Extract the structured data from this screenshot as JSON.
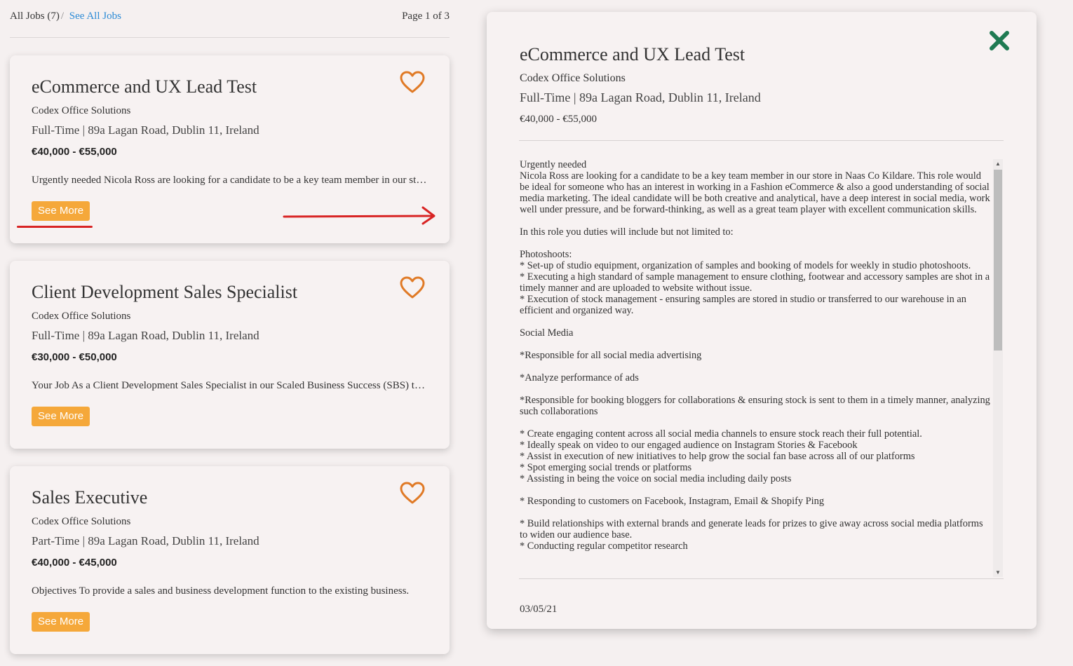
{
  "header": {
    "all_jobs": "All Jobs (7)",
    "separator": "/",
    "see_all": "See All Jobs",
    "page": "Page 1 of 3"
  },
  "cards": [
    {
      "title": "eCommerce and UX Lead Test",
      "company": "Codex Office Solutions",
      "meta": "Full-Time | 89a Lagan Road, Dublin 11, Ireland",
      "salary": "€40,000 - €55,000",
      "desc": "Urgently needed Nicola Ross are looking for a candidate to be a key team member in our store in Naas Co Kildare.",
      "button": "See More"
    },
    {
      "title": "Client Development Sales Specialist",
      "company": "Codex Office Solutions",
      "meta": "Full-Time | 89a Lagan Road, Dublin 11, Ireland",
      "salary": "€30,000 - €50,000",
      "desc": "Your Job As a Client Development Sales Specialist in our Scaled Business Success (SBS) team.",
      "button": "See More"
    },
    {
      "title": "Sales Executive",
      "company": "Codex Office Solutions",
      "meta": "Part-Time | 89a Lagan Road, Dublin 11, Ireland",
      "salary": "€40,000 - €45,000",
      "desc": "Objectives To provide a sales and business development function to the existing business.",
      "button": "See More"
    }
  ],
  "detail": {
    "title": "eCommerce and UX Lead Test",
    "company": "Codex Office Solutions",
    "meta": "Full-Time | 89a Lagan Road, Dublin 11, Ireland",
    "salary": "€40,000 - €55,000",
    "body": "Urgently needed\nNicola Ross are looking for a candidate to be a key team member in our store in Naas Co Kildare. This role would be ideal for someone who has an interest in working in a Fashion eCommerce & also a good understanding of social media marketing. The ideal candidate will be both creative and analytical, have a deep interest in social media, work well under pressure, and be forward-thinking, as well as a great team player with excellent communication skills.\n\nIn this role you duties will include but not limited to:\n\nPhotoshoots:\n* Set-up of studio equipment, organization of samples and booking of models for weekly in studio photoshoots.\n* Executing a high standard of sample management to ensure clothing, footwear and accessory samples are shot in a timely manner and are uploaded to website without issue.\n* Execution of stock management - ensuring samples are stored in studio or transferred to our warehouse in an efficient and organized way.\n\nSocial Media\n\n*Responsible for all social media advertising\n\n*Analyze performance of ads\n\n*Responsible for booking bloggers for collaborations & ensuring stock is sent to them in a timely manner, analyzing such collaborations\n\n* Create engaging content across all social media channels to ensure stock reach their full potential.\n* Ideally speak on video to our engaged audience on Instagram Stories & Facebook\n* Assist in execution of new initiatives to help grow the social fan base across all of our platforms\n* Spot emerging social trends or platforms\n* Assisting in being the voice on social media including daily posts\n\n* Responding to customers on Facebook, Instagram, Email & Shopify Ping\n\n* Build relationships with external brands and generate leads for prizes to give away across social media platforms to widen our audience base.\n* Conducting regular competitor research",
    "date": "03/05/21"
  },
  "colors": {
    "accent_button": "#f5a83a",
    "heart": "#e07a26",
    "close": "#1f7a52",
    "link": "#2a8ad6",
    "annotation": "#d82424"
  },
  "icons": {
    "favorite": "heart-icon",
    "close": "close-icon",
    "scroll_up": "scroll-up-arrow-icon",
    "scroll_down": "scroll-down-arrow-icon",
    "annotation_arrow": "annotation-arrow-icon"
  }
}
